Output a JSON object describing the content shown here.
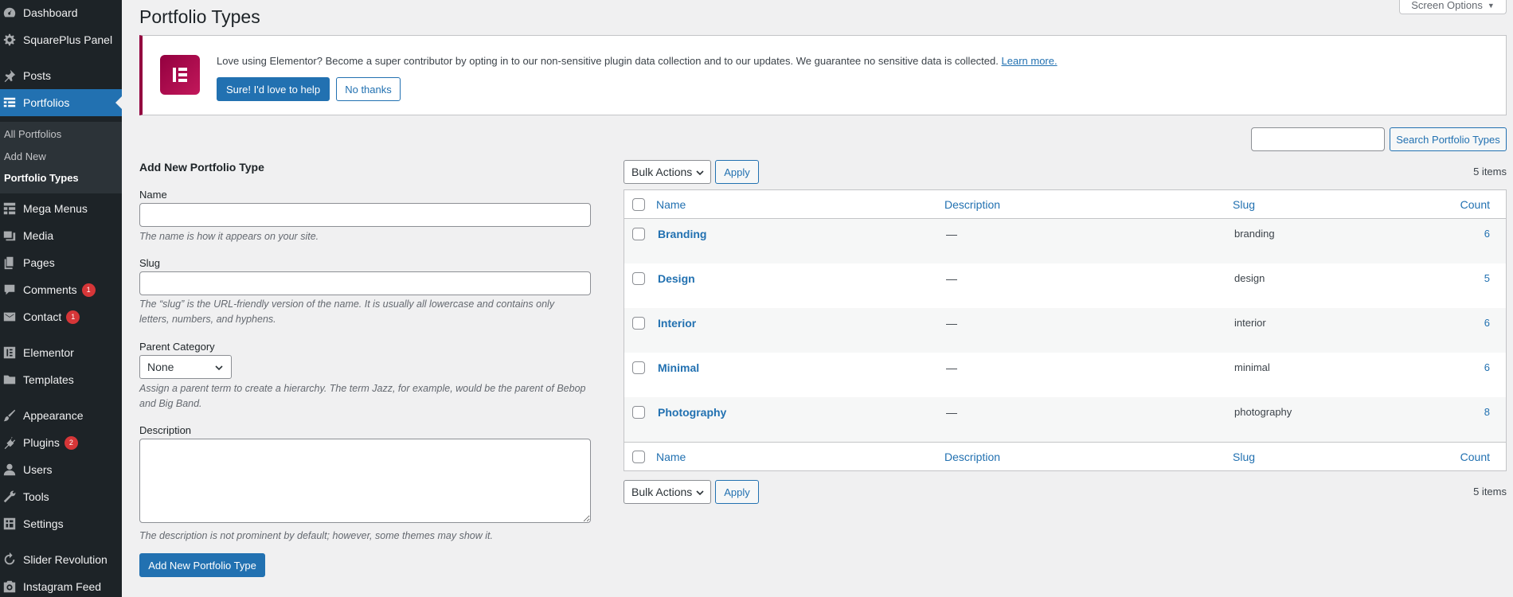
{
  "sidebar": {
    "items": [
      {
        "label": "Dashboard",
        "icon": "dashboard-icon"
      },
      {
        "label": "SquarePlus Panel",
        "icon": "gear-icon"
      },
      {
        "label": "Posts",
        "icon": "pin-icon"
      },
      {
        "label": "Portfolios",
        "icon": "portfolio-icon"
      },
      {
        "label": "Mega Menus",
        "icon": "grid-icon"
      },
      {
        "label": "Media",
        "icon": "media-icon"
      },
      {
        "label": "Pages",
        "icon": "pages-icon"
      },
      {
        "label": "Comments",
        "icon": "comment-icon",
        "badge": "1"
      },
      {
        "label": "Contact",
        "icon": "mail-icon",
        "badge": "1"
      },
      {
        "label": "Elementor",
        "icon": "elementor-icon"
      },
      {
        "label": "Templates",
        "icon": "folder-icon"
      },
      {
        "label": "Appearance",
        "icon": "brush-icon"
      },
      {
        "label": "Plugins",
        "icon": "plugin-icon",
        "badge": "2"
      },
      {
        "label": "Users",
        "icon": "user-icon"
      },
      {
        "label": "Tools",
        "icon": "wrench-icon"
      },
      {
        "label": "Settings",
        "icon": "settings-icon"
      },
      {
        "label": "Slider Revolution",
        "icon": "refresh-icon"
      },
      {
        "label": "Instagram Feed",
        "icon": "instagram-icon"
      }
    ],
    "submenu": [
      {
        "label": "All Portfolios"
      },
      {
        "label": "Add New"
      },
      {
        "label": "Portfolio Types"
      }
    ]
  },
  "header": {
    "title": "Portfolio Types",
    "screen_options": "Screen Options"
  },
  "notice": {
    "text": "Love using Elementor? Become a super contributor by opting in to our non-sensitive plugin data collection and to our updates. We guarantee no sensitive data is collected.",
    "link": "Learn more.",
    "accept_label": "Sure! I'd love to help",
    "decline_label": "No thanks",
    "accent_color": "#93003f"
  },
  "form": {
    "title": "Add New Portfolio Type",
    "name_label": "Name",
    "name_value": "",
    "name_help": "The name is how it appears on your site.",
    "slug_label": "Slug",
    "slug_value": "",
    "slug_help_line1": "The “slug” is the URL-friendly version of the name. It is usually all lowercase and contains only",
    "slug_help_line2": "letters, numbers, and hyphens.",
    "parent_label": "Parent Category",
    "parent_value": "None",
    "parent_help_line1": "Assign a parent term to create a hierarchy. The term Jazz, for example, would be the parent of Bebop",
    "parent_help_line2": "and Big Band.",
    "description_label": "Description",
    "description_value": "",
    "description_help": "The description is not prominent by default; however, some themes may show it.",
    "submit_label": "Add New Portfolio Type"
  },
  "table": {
    "search_value": "",
    "search_button": "Search Portfolio Types",
    "bulk_actions": "Bulk Actions",
    "apply": "Apply",
    "items_count": "5 items",
    "columns": {
      "name": "Name",
      "description": "Description",
      "slug": "Slug",
      "count": "Count"
    },
    "rows": [
      {
        "name": "Branding",
        "description": "—",
        "slug": "branding",
        "count": "6"
      },
      {
        "name": "Design",
        "description": "—",
        "slug": "design",
        "count": "5"
      },
      {
        "name": "Interior",
        "description": "—",
        "slug": "interior",
        "count": "6"
      },
      {
        "name": "Minimal",
        "description": "—",
        "slug": "minimal",
        "count": "6"
      },
      {
        "name": "Photography",
        "description": "—",
        "slug": "photography",
        "count": "8"
      }
    ]
  },
  "colors": {
    "primary": "#2271b1",
    "sidebar_bg": "#1d2327",
    "badge": "#d63638"
  }
}
